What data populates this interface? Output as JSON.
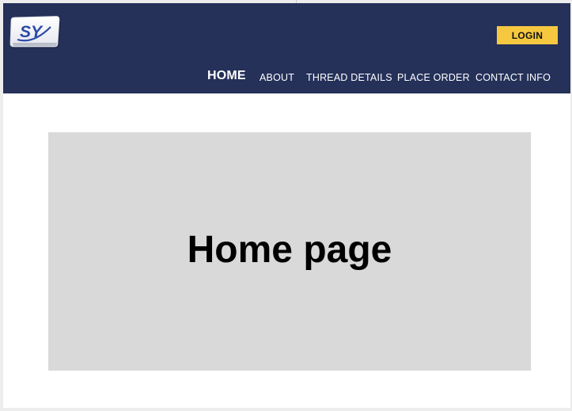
{
  "header": {
    "logo_text": "SY",
    "login_label": "LOGIN",
    "nav": [
      {
        "label": "HOME"
      },
      {
        "label": "ABOUT"
      },
      {
        "label": "THREAD DETAILS"
      },
      {
        "label": "PLACE ORDER"
      },
      {
        "label": "CONTACT INFO"
      }
    ]
  },
  "main": {
    "hero_title": "Home page"
  },
  "colors": {
    "header_bg": "#253159",
    "login_bg": "#f6c840",
    "hero_bg": "#d9d9d9",
    "logo_blue": "#2a4aa8"
  }
}
